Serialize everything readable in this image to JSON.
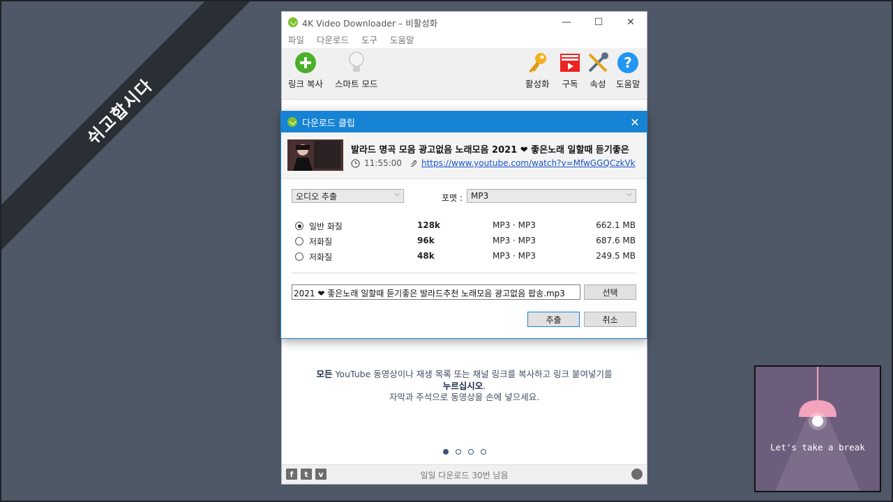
{
  "banner": {
    "text": "쉬고합시다"
  },
  "app": {
    "title": "4K Video Downloader – 비활성화",
    "menu": [
      "파일",
      "다운로드",
      "도구",
      "도움말"
    ],
    "toolbar": {
      "paste_link": "링크 복사",
      "smart_mode": "스마트 모드",
      "activate": "활성화",
      "subscriptions": "구독",
      "preferences": "속성",
      "help": "도움말"
    },
    "message": {
      "bold1": "모든",
      "part1": " YouTube 동영상이나 재생 목록 또는 채널 링크를 복사하고 링크 붙여넣기를",
      "bold2": "누르십시오",
      "part2": ".",
      "line3": "자막과 주석으로 동영상을 손에 넣으세요."
    },
    "footer": {
      "status": "일일 다운로드 30번 남음"
    }
  },
  "dialog": {
    "title": "다운로드 클립",
    "clip_title": "발라드 명곡 모음 광고없음 노래모음 2021 ❤ 좋은노래 일할때 듣기좋은",
    "duration": "11:55:00",
    "url": "https://www.youtube.com/watch?v=MfwGGQCzkVk",
    "mode_select": "오디오 추출",
    "format_label": "포맷 :",
    "format_select": "MP3",
    "qualities": [
      {
        "name": "일반 화질",
        "bitrate": "128k",
        "codec": "MP3 · MP3",
        "size": "662.1 MB",
        "selected": true
      },
      {
        "name": "저화질",
        "bitrate": "96k",
        "codec": "MP3 · MP3",
        "size": "687.6 MB",
        "selected": false
      },
      {
        "name": "저화질",
        "bitrate": "48k",
        "codec": "MP3 · MP3",
        "size": "249.5 MB",
        "selected": false
      }
    ],
    "filename": "2021 ❤ 좋은노래 일할때 듣기좋은 발라드추천 노래모음 광고없음 팝송.mp3",
    "choose_button": "선택",
    "extract_button": "추출",
    "cancel_button": "취소"
  },
  "break_card": {
    "text": "Let's take a break"
  },
  "colors": {
    "accent": "#1783d4",
    "background": "#4f5866",
    "break_bg": "#6d5d7c",
    "lamp": "#f3a3bc"
  }
}
